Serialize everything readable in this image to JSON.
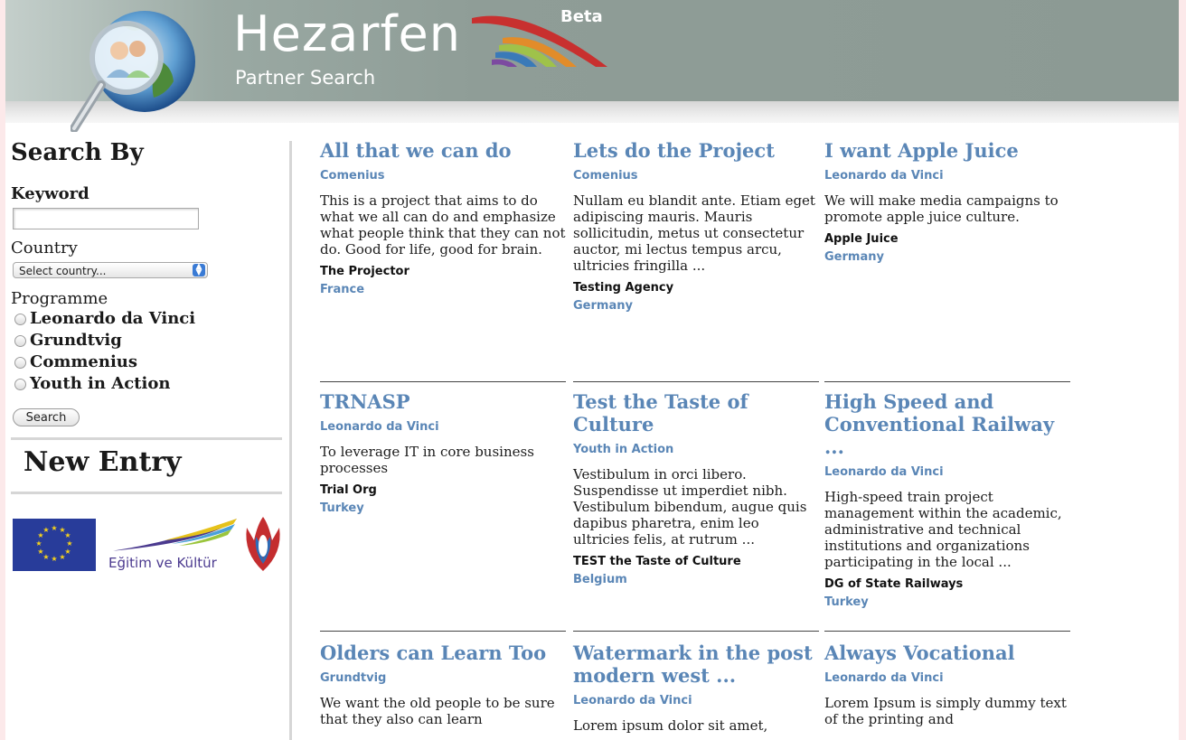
{
  "header": {
    "title": "Hezarfen",
    "subtitle": "Partner Search",
    "badge": "Beta"
  },
  "sidebar": {
    "search_heading": "Search By",
    "keyword_label": "Keyword",
    "keyword_value": "",
    "country_label": "Country",
    "country_selected": "Select country...",
    "programme_label": "Programme",
    "programmes": [
      "Leonardo da Vinci",
      "Grundtvig",
      "Commenius",
      "Youth in Action"
    ],
    "search_button": "Search",
    "new_entry": "New Entry",
    "partner_logo_text": "Eğitim ve Kültür"
  },
  "projects": [
    {
      "title": "All that we can do",
      "programme": "Comenius",
      "description": "This is a project that aims to do what we all can do and emphasize what people think that they can not do. Good for life, good for brain.",
      "organization": "The Projector",
      "country": "France"
    },
    {
      "title": "Lets do the Project",
      "programme": "Comenius",
      "description": "Nullam eu blandit ante. Etiam eget adipiscing mauris. Mauris sollicitudin, metus ut consectetur auctor, mi lectus tempus arcu, ultricies fringilla ...",
      "organization": "Testing Agency",
      "country": "Germany"
    },
    {
      "title": "I want Apple Juice",
      "programme": "Leonardo da Vinci",
      "description": "We will make media campaigns to promote apple juice culture.",
      "organization": "Apple Juice",
      "country": "Germany"
    },
    {
      "title": "TRNASP",
      "programme": "Leonardo da Vinci",
      "description": "To leverage IT in core business processes",
      "organization": "Trial Org",
      "country": "Turkey"
    },
    {
      "title": "Test the Taste of Culture",
      "programme": "Youth in Action",
      "description": "Vestibulum in orci libero. Suspendisse ut imperdiet nibh. Vestibulum bibendum, augue quis dapibus pharetra, enim leo ultricies felis, at rutrum ...",
      "organization": "TEST the Taste of Culture",
      "country": "Belgium"
    },
    {
      "title": "High Speed and Conventional Railway ...",
      "programme": "Leonardo da Vinci",
      "description": "High-speed train project management within the academic, administrative and technical institutions and organizations participating in the local ...",
      "organization": "DG of State Railways",
      "country": "Turkey"
    },
    {
      "title": "Olders can Learn Too",
      "programme": "Grundtvig",
      "description": "We want the old people to be sure that they also can learn",
      "organization": "",
      "country": ""
    },
    {
      "title": "Watermark in the post modern west ...",
      "programme": "Leonardo da Vinci",
      "description": "Lorem ipsum dolor sit amet,",
      "organization": "",
      "country": ""
    },
    {
      "title": "Always Vocational",
      "programme": "Leonardo da Vinci",
      "description": "Lorem Ipsum is simply dummy text of the printing and",
      "organization": "",
      "country": ""
    }
  ]
}
